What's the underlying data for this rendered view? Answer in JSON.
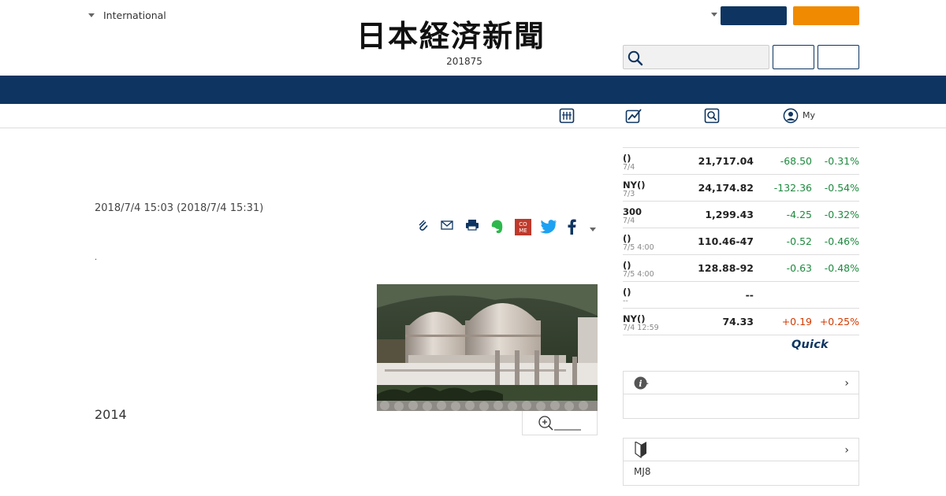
{
  "header": {
    "edition": "International",
    "logo_text": "日本経済新聞",
    "issue_number": "201875"
  },
  "article": {
    "date": "2018/7/4 15:03 (2018/7/4 15:31)",
    "dot": ".",
    "year": "2014"
  },
  "subnav": {
    "my_label": "My"
  },
  "markets": {
    "rows": [
      {
        "name": "()",
        "time": "7/4",
        "price": "21,717.04",
        "change": "-68.50",
        "percent": "-0.31%",
        "direction": "down"
      },
      {
        "name": "NY()",
        "time": "7/3",
        "price": "24,174.82",
        "change": "-132.36",
        "percent": "-0.54%",
        "direction": "down"
      },
      {
        "name": "300",
        "time": "7/4",
        "price": "1,299.43",
        "change": "-4.25",
        "percent": "-0.32%",
        "direction": "down"
      },
      {
        "name": "()",
        "time": "7/5 4:00",
        "price": "110.46-47",
        "change": "-0.52",
        "percent": "-0.46%",
        "direction": "down"
      },
      {
        "name": "()",
        "time": "7/5 4:00",
        "price": "128.88-92",
        "change": "-0.63",
        "percent": "-0.48%",
        "direction": "down"
      },
      {
        "name": "()",
        "time": "--",
        "price": "--",
        "change": "",
        "percent": "",
        "direction": "none"
      },
      {
        "name": "NY()",
        "time": "7/4 12:59",
        "price": "74.33",
        "change": "+0.19",
        "percent": "+0.25%",
        "direction": "up"
      }
    ],
    "provider": "Quick"
  },
  "sidebar": {
    "box2_text": "MJ8"
  },
  "colors": {
    "navy": "#0e3561",
    "orange": "#f08a00",
    "negative": "#1e8a3f",
    "positive": "#d23a00"
  },
  "icons": {
    "share": [
      "clip-icon",
      "mail-icon",
      "print-icon",
      "evernote-icon",
      "come-icon",
      "twitter-icon",
      "facebook-icon",
      "more-dropdown-icon"
    ],
    "subnav": [
      "portfolio-icon",
      "chart-icon",
      "search-screen-icon",
      "user-icon"
    ]
  }
}
